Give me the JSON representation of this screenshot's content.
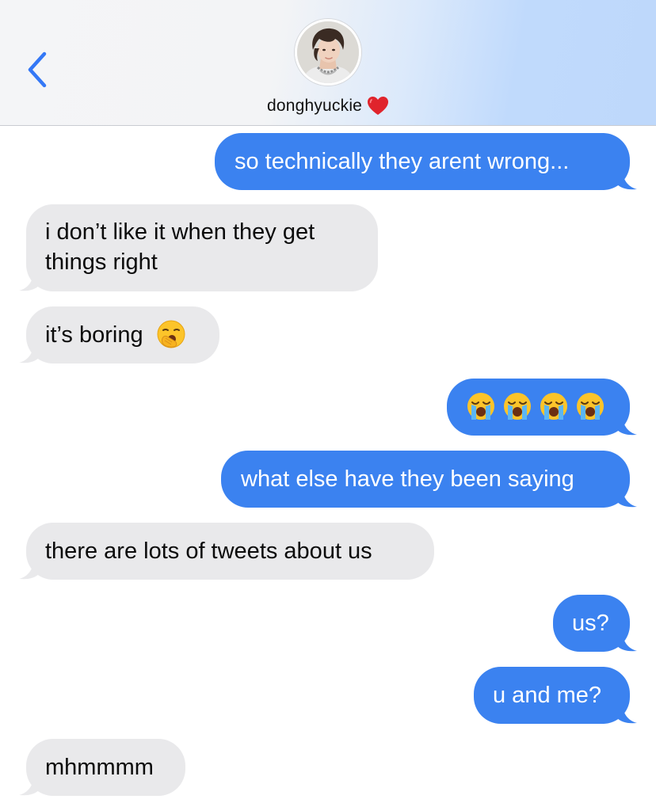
{
  "header": {
    "contact_name": "donghyuckie",
    "back_icon": "chevron-left-icon",
    "name_emoji": "red-heart-icon",
    "accent_color": "#3b82f0"
  },
  "messages": [
    {
      "direction": "sent",
      "text": "so technically they arent wrong..."
    },
    {
      "direction": "received",
      "text": "i don’t like it when they get things right"
    },
    {
      "direction": "received",
      "text": "it’s boring",
      "emoji": "yawning-face-icon"
    },
    {
      "direction": "sent",
      "emoji_only": [
        "loudly-crying-face-icon",
        "loudly-crying-face-icon",
        "loudly-crying-face-icon",
        "loudly-crying-face-icon"
      ]
    },
    {
      "direction": "sent",
      "text": "what else have they been saying"
    },
    {
      "direction": "received",
      "text": "there are lots of tweets about us"
    },
    {
      "direction": "sent",
      "text": "us?"
    },
    {
      "direction": "sent",
      "text": "u and me?"
    },
    {
      "direction": "received",
      "text": "mhmmmm"
    }
  ],
  "colors": {
    "sent_bubble": "#3b82f0",
    "received_bubble": "#e9e9eb"
  }
}
